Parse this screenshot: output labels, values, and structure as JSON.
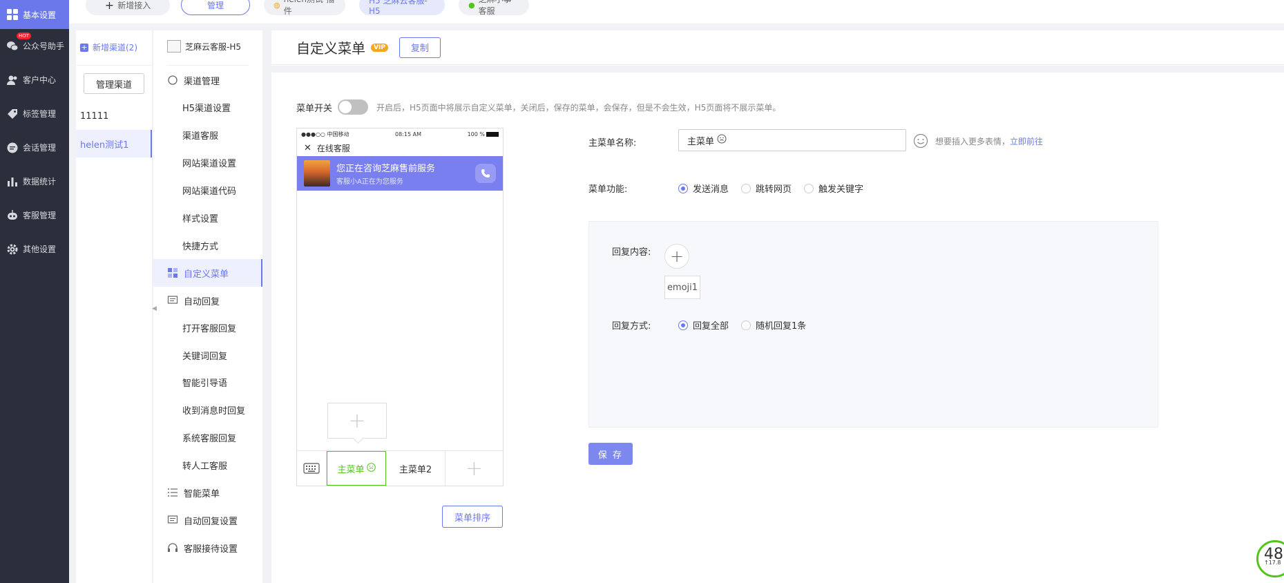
{
  "leftnav": {
    "items": [
      {
        "label": "基本设置",
        "icon": "grid-icon"
      },
      {
        "label": "公众号助手",
        "icon": "wechat-icon",
        "badge": "HOT"
      },
      {
        "label": "客户中心",
        "icon": "users-icon"
      },
      {
        "label": "标签管理",
        "icon": "tag-icon"
      },
      {
        "label": "会话管理",
        "icon": "chat-icon"
      },
      {
        "label": "数据统计",
        "icon": "bar-chart-icon"
      },
      {
        "label": "客服管理",
        "icon": "robot-icon"
      },
      {
        "label": "其他设置",
        "icon": "gear-icon"
      }
    ]
  },
  "tabs": {
    "new_access": "新增接入",
    "manage": "管理",
    "plugin": "helen测试-插件",
    "h5": "H5 芝麻云客服-H5",
    "mini": "芝麻小事客服"
  },
  "channels": {
    "add_label": "新增渠道(2)",
    "manage_label": "管理渠道",
    "items": [
      "11111",
      "helen测试1"
    ]
  },
  "menu": {
    "channel_name": "芝麻云客服-H5",
    "items": [
      "渠道管理",
      "H5渠道设置",
      "渠道客服",
      "网站渠道设置",
      "网站渠道代码",
      "样式设置",
      "快捷方式",
      "自定义菜单",
      "自动回复",
      "打开客服回复",
      "关键词回复",
      "智能引导语",
      "收到消息时回复",
      "系统客服回复",
      "转人工客服",
      "智能菜单",
      "自动回复设置",
      "客服接待设置"
    ]
  },
  "page": {
    "title": "自定义菜单",
    "vip": "VIP",
    "copy": "复制",
    "switch_label": "菜单开关",
    "switch_on": false,
    "switch_hint": "开启后，H5页面中将展示自定义菜单，关闭后，保存的菜单，会保存，但是不会生效，H5页面将不展示菜单。"
  },
  "phone": {
    "carrier": "●●●○○ 中国移动",
    "time": "08:15 AM",
    "battery": "100 %",
    "header": "在线客服",
    "banner_title": "您正在咨询芝麻售前服务",
    "banner_sub": "客服小A正在为您服务",
    "menu1": "主菜单",
    "menu2": "主菜单2",
    "sort": "菜单排序"
  },
  "form": {
    "name_label": "主菜单名称:",
    "name_value": "主菜单",
    "emoji_hint": "想要插入更多表情，",
    "emoji_link": "立即前往",
    "func_label": "菜单功能:",
    "func_options": [
      "发送消息",
      "跳转网页",
      "触发关键字"
    ],
    "func_selected": 0,
    "reply_label": "回复内容:",
    "reply_item": "emoji1",
    "mode_label": "回复方式:",
    "mode_options": [
      "回复全部",
      "随机回复1条"
    ],
    "mode_selected": 0,
    "save": "保 存"
  },
  "perf": {
    "value": "48",
    "sub": "↑17.8"
  }
}
